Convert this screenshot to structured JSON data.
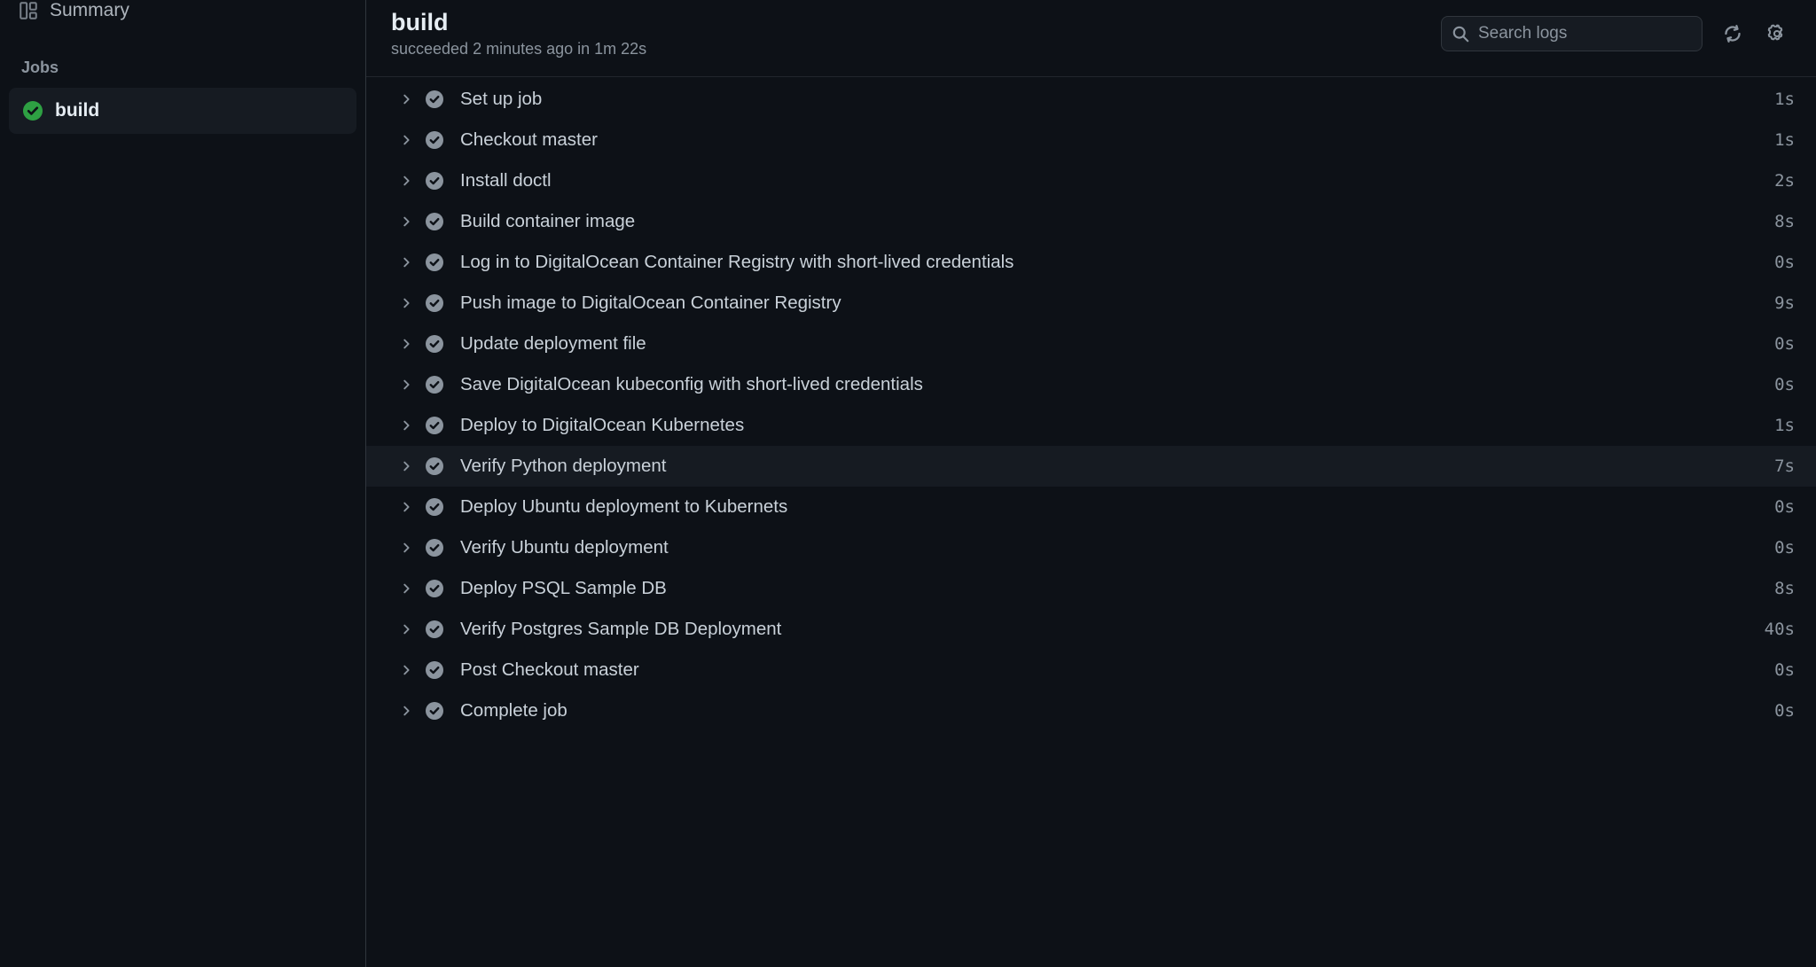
{
  "sidebar": {
    "summary_label": "Summary",
    "jobs_label": "Jobs",
    "job": {
      "name": "build",
      "status": "success"
    }
  },
  "header": {
    "title": "build",
    "subtitle": "succeeded 2 minutes ago in 1m 22s",
    "search_placeholder": "Search logs"
  },
  "colors": {
    "success": "#2ea043",
    "step_check_bg": "#8b949e",
    "step_check_fg": "#0d1117"
  },
  "steps": [
    {
      "name": "Set up job",
      "duration": "1s"
    },
    {
      "name": "Checkout master",
      "duration": "1s"
    },
    {
      "name": "Install doctl",
      "duration": "2s"
    },
    {
      "name": "Build container image",
      "duration": "8s"
    },
    {
      "name": "Log in to DigitalOcean Container Registry with short-lived credentials",
      "duration": "0s"
    },
    {
      "name": "Push image to DigitalOcean Container Registry",
      "duration": "9s"
    },
    {
      "name": "Update deployment file",
      "duration": "0s"
    },
    {
      "name": "Save DigitalOcean kubeconfig with short-lived credentials",
      "duration": "0s"
    },
    {
      "name": "Deploy to DigitalOcean Kubernetes",
      "duration": "1s"
    },
    {
      "name": "Verify Python deployment",
      "duration": "7s",
      "highlight": true
    },
    {
      "name": "Deploy Ubuntu deployment to Kubernets",
      "duration": "0s"
    },
    {
      "name": "Verify Ubuntu deployment",
      "duration": "0s"
    },
    {
      "name": "Deploy PSQL Sample DB",
      "duration": "8s"
    },
    {
      "name": "Verify Postgres Sample DB Deployment",
      "duration": "40s"
    },
    {
      "name": "Post Checkout master",
      "duration": "0s"
    },
    {
      "name": "Complete job",
      "duration": "0s"
    }
  ]
}
